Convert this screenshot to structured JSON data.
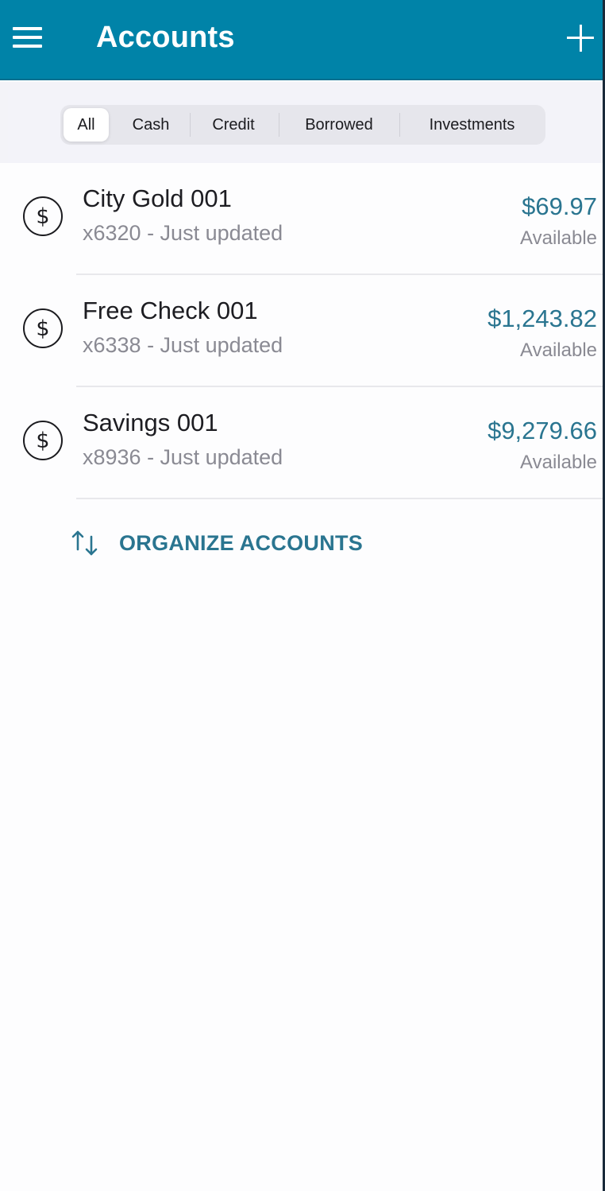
{
  "header": {
    "title": "Accounts",
    "menu_icon": "hamburger-menu-icon",
    "add_icon": "plus-icon"
  },
  "filters": {
    "selected": "All",
    "items": [
      {
        "label": "All"
      },
      {
        "label": "Cash"
      },
      {
        "label": "Credit"
      },
      {
        "label": "Borrowed"
      },
      {
        "label": "Investments"
      }
    ]
  },
  "accounts": [
    {
      "name": "City Gold 001",
      "subtitle": "x6320 - Just updated",
      "amount": "$69.97",
      "amount_label": "Available",
      "icon": "dollar-circle-icon"
    },
    {
      "name": "Free Check 001",
      "subtitle": "x6338 - Just updated",
      "amount": "$1,243.82",
      "amount_label": "Available",
      "icon": "dollar-circle-icon"
    },
    {
      "name": "Savings 001",
      "subtitle": "x8936 - Just updated",
      "amount": "$9,279.66",
      "amount_label": "Available",
      "icon": "dollar-circle-icon"
    }
  ],
  "organize": {
    "label": "ORGANIZE ACCOUNTS",
    "icon": "sort-arrows-icon"
  },
  "colors": {
    "header_bg": "#0083a8",
    "accent": "#2a7590",
    "muted_text": "#8a8a93"
  }
}
